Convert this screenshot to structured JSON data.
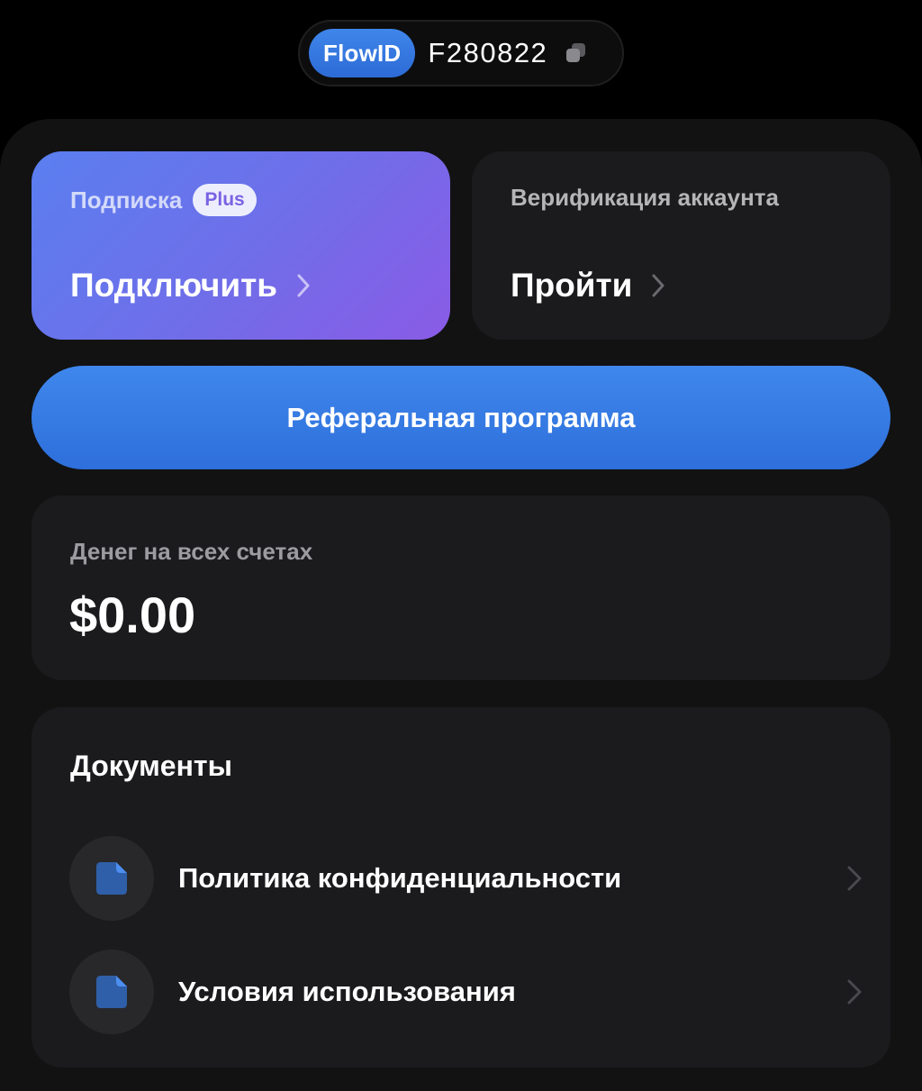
{
  "header": {
    "badge": "FlowID",
    "id": "F280822",
    "copy_icon": "copy-icon"
  },
  "subscription": {
    "label": "Подписка",
    "badge": "Plus",
    "action": "Подключить"
  },
  "verification": {
    "label": "Верификация аккаунта",
    "action": "Пройти"
  },
  "referral": {
    "label": "Реферальная программа"
  },
  "balance": {
    "label": "Денег на всех счетах",
    "value": "$0.00"
  },
  "documents": {
    "title": "Документы",
    "items": [
      {
        "label": "Политика конфиденциальности",
        "icon": "document-icon"
      },
      {
        "label": "Условия использования",
        "icon": "document-icon"
      }
    ]
  },
  "colors": {
    "background": "#000000",
    "panel": "#121213",
    "card": "#1b1b1d",
    "accent_blue": "#3a7ce6",
    "subscription_gradient_start": "#5a7ff0",
    "subscription_gradient_end": "#8a5be6"
  }
}
